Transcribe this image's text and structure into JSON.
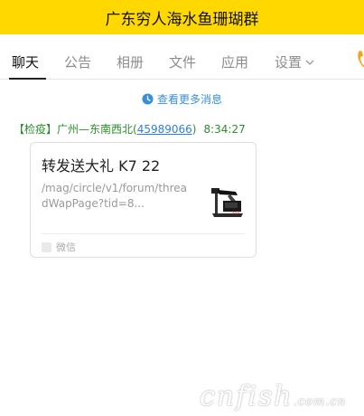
{
  "window": {
    "title": "广东穷人海水鱼珊瑚群"
  },
  "tabs": [
    {
      "label": "聊天",
      "active": true
    },
    {
      "label": "公告"
    },
    {
      "label": "相册"
    },
    {
      "label": "文件"
    },
    {
      "label": "应用"
    },
    {
      "label": "设置"
    }
  ],
  "history": {
    "label": "查看更多消息",
    "icon": "clock-icon"
  },
  "message": {
    "sender_tag": "【检疫】广州—东南西北(",
    "sender_qq": "45989066",
    "sender_close": ")",
    "time": "8:34:27",
    "card": {
      "title": "转发送大礼 K7 22",
      "url": "/mag/circle/v1/forum/threadWapPage?tid=8...",
      "source": "微信",
      "thumb_icon": "product-thumbnail"
    }
  },
  "watermark": {
    "text": "cnfish",
    "sub": ".com.cn"
  },
  "colors": {
    "titlebar": "#ffd800",
    "link": "#3a8fd6",
    "sender": "#2a8f2a"
  }
}
